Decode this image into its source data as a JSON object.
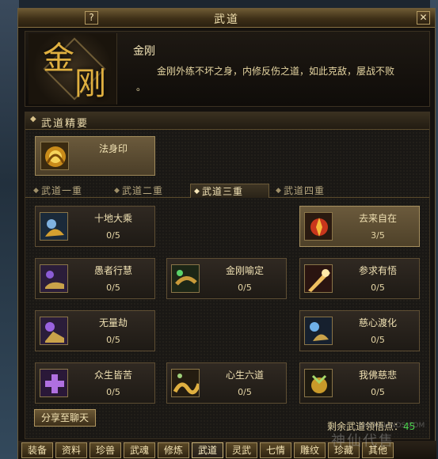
{
  "window": {
    "title": "武道",
    "help_label": "?",
    "close_label": "✕"
  },
  "header": {
    "emblem_char_1": "金",
    "emblem_char_2": "刚",
    "skill_name": "金刚",
    "description_line1": "金刚外练不坏之身，内修反伤之道，如此克敌，屡战不败",
    "description_line2": "。"
  },
  "essence": {
    "section_label": "武道精要",
    "item": {
      "name": "法身印",
      "icon": "golden-fist-icon"
    }
  },
  "tabs": [
    {
      "label": "武道一重",
      "active": false
    },
    {
      "label": "武道二重",
      "active": false
    },
    {
      "label": "武道三重",
      "active": true
    },
    {
      "label": "武道四重",
      "active": false
    }
  ],
  "skills": [
    {
      "name": "十地大乘",
      "level": "0/5",
      "icon": "golden-palm-icon",
      "active": false
    },
    {
      "name": "去来自在",
      "level": "3/5",
      "icon": "flame-circle-icon",
      "active": true
    },
    {
      "name": "愚者行慧",
      "level": "0/5",
      "icon": "purple-foot-icon",
      "active": false
    },
    {
      "name": "金刚喻定",
      "level": "0/5",
      "icon": "green-swirl-icon",
      "active": false
    },
    {
      "name": "参求有悟",
      "level": "0/5",
      "icon": "light-beam-icon",
      "active": false
    },
    {
      "name": "无量劫",
      "level": "0/5",
      "icon": "purple-fist-icon",
      "active": false
    },
    {
      "name": "慈心渡化",
      "level": "0/5",
      "icon": "blue-hand-icon",
      "active": false
    },
    {
      "name": "众生皆苦",
      "level": "0/5",
      "icon": "purple-cross-icon",
      "active": false
    },
    {
      "name": "心生六道",
      "level": "0/5",
      "icon": "golden-wave-icon",
      "active": false
    },
    {
      "name": "我佛慈悲",
      "level": "0/5",
      "icon": "golden-rune-icon",
      "active": false
    }
  ],
  "footer": {
    "share_label": "分享至聊天",
    "points_label": "剩余武道领悟点：",
    "points_value": "45"
  },
  "bottom_tabs": [
    {
      "label": "装备",
      "active": false
    },
    {
      "label": "资料",
      "active": false
    },
    {
      "label": "珍兽",
      "active": false
    },
    {
      "label": "武魂",
      "active": false
    },
    {
      "label": "修炼",
      "active": false
    },
    {
      "label": "武道",
      "active": true
    },
    {
      "label": "灵武",
      "active": false
    },
    {
      "label": "七情",
      "active": false
    },
    {
      "label": "雕纹",
      "active": false
    },
    {
      "label": "珍藏",
      "active": false
    },
    {
      "label": "其他",
      "active": false
    }
  ],
  "watermark": {
    "text": "神仙代售",
    "small": "SHENXIANDS.COM"
  },
  "colors": {
    "accent_gold": "#e0b040",
    "points_green": "#48d24a",
    "frame": "#6b5a38"
  }
}
